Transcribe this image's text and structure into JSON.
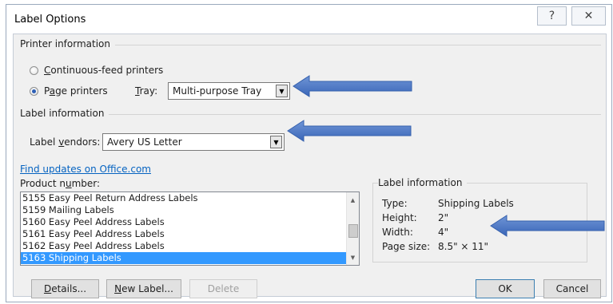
{
  "window": {
    "title": "Label Options",
    "help_glyph": "?",
    "close_glyph": "✕"
  },
  "printer_info": {
    "heading": "Printer information",
    "continuous": {
      "pre": "",
      "mn": "C",
      "post": "ontinuous-feed printers",
      "checked": false
    },
    "page": {
      "pre": "P",
      "mn": "a",
      "post": "ge printers",
      "checked": true
    },
    "tray": {
      "mn": "T",
      "post": "ray:",
      "value": "Multi-purpose Tray"
    }
  },
  "label_info_section": {
    "heading": "Label information",
    "vendors": {
      "pre": "Label ",
      "mn": "v",
      "post": "endors:",
      "value": "Avery US Letter"
    }
  },
  "updates_link": "Find updates on Office.com",
  "product": {
    "label": {
      "pre": "Product n",
      "mn": "u",
      "post": "mber:"
    },
    "items": [
      "5155 Easy Peel Return Address Labels",
      "5159 Mailing Labels",
      "5160 Easy Peel Address Labels",
      "5161 Easy Peel Address Labels",
      "5162 Easy Peel Address Labels",
      "5163 Shipping Labels"
    ],
    "selected_index": 5
  },
  "details": {
    "heading": "Label information",
    "type": {
      "key": "Type:",
      "value": "Shipping Labels"
    },
    "height": {
      "key": "Height:",
      "value": "2\""
    },
    "width": {
      "key": "Width:",
      "value": "4\""
    },
    "page_size": {
      "key": "Page size:",
      "value": "8.5\" × 11\""
    }
  },
  "buttons": {
    "details": {
      "mn": "D",
      "post": "etails..."
    },
    "new_label": {
      "mn": "N",
      "post": "ew Label..."
    },
    "delete": "Delete",
    "ok": "OK",
    "cancel": "Cancel"
  },
  "colors": {
    "arrow": "#4472c4",
    "selection": "#3399ff",
    "link": "#0563c1"
  }
}
